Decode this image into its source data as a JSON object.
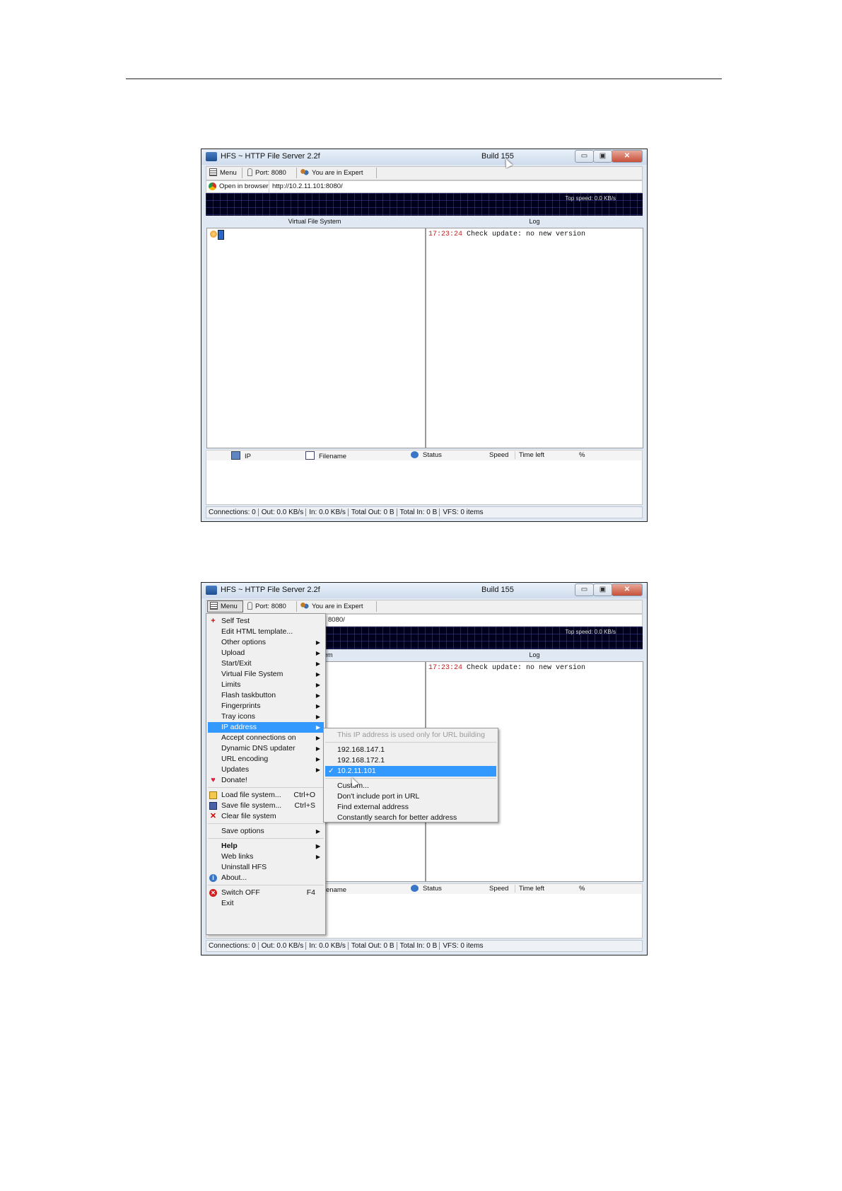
{
  "app": {
    "title": "HFS ~ HTTP File Server 2.2f",
    "build": "Build 155",
    "window_buttons": {
      "minimize": "▭",
      "maximize": "▣",
      "close": "✕"
    }
  },
  "toolbar": {
    "menu_label": "Menu",
    "port_label": "Port: 8080",
    "expert_label": "You are in Expert mode"
  },
  "browser_bar": {
    "label": "Open in browser",
    "url": "http://10.2.11.101:8080/",
    "url_partial": "8080/"
  },
  "graph": {
    "top_speed": "Top speed: 0.0 KB/s"
  },
  "panes": {
    "vfs_header": "Virtual File System",
    "vfs_header_partial": "stem",
    "log_header": "Log"
  },
  "log": [
    {
      "time": "17:23:24",
      "message": "Check update: no new version"
    }
  ],
  "connections_header": {
    "ip": "IP",
    "filename": "Filename",
    "status": "Status",
    "speed": "Speed",
    "time_left": "Time left",
    "percent": "%"
  },
  "status_bar": {
    "connections": "Connections: 0",
    "out": "Out: 0.0 KB/s",
    "in": "In: 0.0 KB/s",
    "total_out": "Total Out: 0 B",
    "total_in": "Total In: 0 B",
    "vfs": "VFS: 0 items"
  },
  "main_menu": {
    "items": [
      {
        "label": "Self Test",
        "icon": "plus-icon",
        "submenu": false
      },
      {
        "label": "Edit HTML template...",
        "submenu": false
      },
      {
        "label": "Other options",
        "submenu": true
      },
      {
        "label": "Upload",
        "submenu": true
      },
      {
        "label": "Start/Exit",
        "submenu": true
      },
      {
        "label": "Virtual File System",
        "submenu": true
      },
      {
        "label": "Limits",
        "submenu": true
      },
      {
        "label": "Flash taskbutton",
        "submenu": true
      },
      {
        "label": "Fingerprints",
        "submenu": true
      },
      {
        "label": "Tray icons",
        "submenu": true
      },
      {
        "label": "IP address",
        "submenu": true,
        "highlighted": true
      },
      {
        "label": "Accept connections on",
        "submenu": true
      },
      {
        "label": "Dynamic DNS updater",
        "submenu": true
      },
      {
        "label": "URL encoding",
        "submenu": true
      },
      {
        "label": "Updates",
        "submenu": true
      },
      {
        "label": "Donate!",
        "icon": "heart-icon",
        "submenu": false
      },
      {
        "label": "Load file system...",
        "shortcut": "Ctrl+O",
        "icon": "folder-open-icon"
      },
      {
        "label": "Save file system...",
        "shortcut": "Ctrl+S",
        "icon": "floppy-disk-icon"
      },
      {
        "label": "Clear file system",
        "icon": "red-x-icon"
      },
      {
        "label": "Save options",
        "submenu": true
      },
      {
        "label": "Help",
        "submenu": true,
        "bold": true
      },
      {
        "label": "Web links",
        "submenu": true
      },
      {
        "label": "Uninstall HFS"
      },
      {
        "label": "About...",
        "icon": "info-icon"
      },
      {
        "label": "Switch OFF",
        "shortcut": "F4",
        "icon": "power-off-icon"
      },
      {
        "label": "Exit"
      }
    ]
  },
  "ip_submenu": {
    "note": "This IP address is used only for URL building",
    "addresses": [
      "192.168.147.1",
      "192.168.172.1",
      "10.2.11.101"
    ],
    "selected": "10.2.11.101",
    "actions": [
      "Custom...",
      "Don't include port in URL",
      "Find external address",
      "Constantly search for better address"
    ]
  },
  "colors": {
    "highlight": "#3399ff",
    "graph_bg": "#00001c",
    "log_time": "#c02020",
    "titlebar": "#dfe8f3"
  }
}
